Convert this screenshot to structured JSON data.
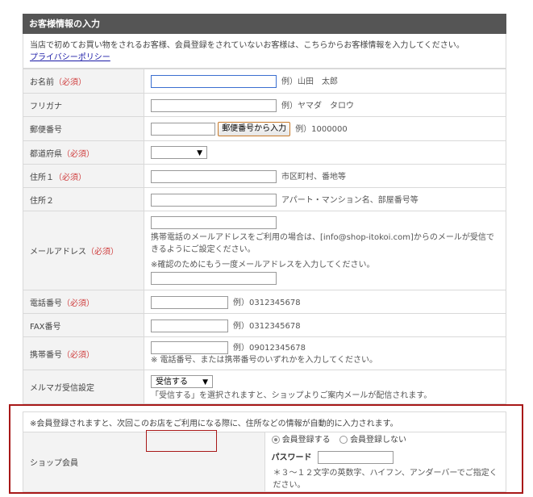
{
  "section_title": "お客様情報の入力",
  "intro_text": "当店で初めてお買い物をされるお客様、会員登録をされていないお客様は、こちらからお客様情報を入力してください。",
  "privacy_link": "プライバシーポリシー",
  "required_mark": "（必須）",
  "fields": {
    "name": {
      "label": "お名前",
      "example": "例）山田　太郎"
    },
    "kana": {
      "label": "フリガナ",
      "example": "例）ヤマダ　タロウ"
    },
    "zip": {
      "label": "郵便番号",
      "button": "郵便番号から入力",
      "example": "例）1000000"
    },
    "pref": {
      "label": "都道府県",
      "value": ""
    },
    "addr1": {
      "label": "住所１",
      "example": "市区町村、番地等"
    },
    "addr2": {
      "label": "住所２",
      "example": "アパート・マンション名、部屋番号等"
    },
    "email": {
      "label": "メールアドレス",
      "note1": "携帯電話のメールアドレスをご利用の場合は、[info@shop-itokoi.com]からのメールが受信できるようにご設定ください。",
      "note2": "※確認のためにもう一度メールアドレスを入力してください。"
    },
    "tel": {
      "label": "電話番号",
      "example": "例）0312345678"
    },
    "fax": {
      "label": "FAX番号",
      "example": "例）0312345678"
    },
    "mobile": {
      "label": "携帯番号",
      "example": "例）09012345678",
      "note": "※ 電話番号、または携帯番号のいずれかを入力してください。"
    },
    "magazine": {
      "label": "メルマガ受信設定",
      "value": "受信する",
      "note": "「受信する」を選択されますと、ショップよりご案内メールが配信されます。"
    }
  },
  "membership": {
    "notice": "※会員登録されますと、次回このお店をご利用になる際に、住所などの情報が自動的に入力されます。",
    "label": "ショップ会員",
    "opt_register": "会員登録する",
    "opt_no_register": "会員登録しない",
    "password_label": "パスワード",
    "password_note": "＊３～１２文字の英数字、ハイフン、アンダーバーでご指定ください。"
  }
}
